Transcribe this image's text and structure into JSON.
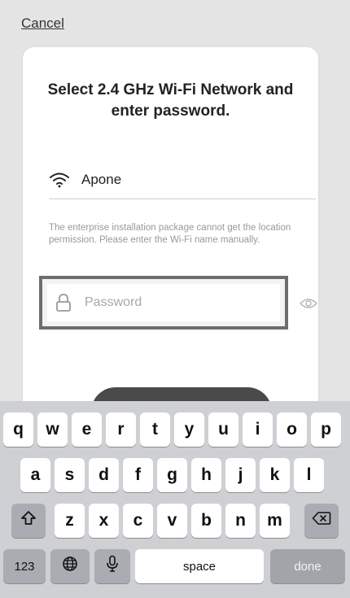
{
  "header": {
    "cancel_label": "Cancel"
  },
  "card": {
    "title": "Select 2.4 GHz Wi-Fi Network and enter password.",
    "wifi_name": "Apone",
    "wifi_icon": "wifi-icon",
    "notice": "The enterprise installation package cannot get the location permission. Please enter the Wi-Fi name manually.",
    "password_placeholder": "Password",
    "password_value": "",
    "lock_icon": "lock-icon",
    "eye_icon": "eye-icon"
  },
  "keyboard": {
    "row1": [
      "q",
      "w",
      "e",
      "r",
      "t",
      "y",
      "u",
      "i",
      "o",
      "p"
    ],
    "row2": [
      "a",
      "s",
      "d",
      "f",
      "g",
      "h",
      "j",
      "k",
      "l"
    ],
    "row3": [
      "z",
      "x",
      "c",
      "v",
      "b",
      "n",
      "m"
    ],
    "shift_icon": "shift-icon",
    "delete_icon": "delete-icon",
    "numbers_label": "123",
    "globe_icon": "globe-icon",
    "mic_icon": "microphone-icon",
    "space_label": "space",
    "done_label": "done"
  },
  "colors": {
    "background": "#e4e4e4",
    "card": "#ffffff",
    "highlight_border": "#6d6d6d",
    "confirm_button": "#4a4a4a",
    "keyboard_bg": "#cfd0d4",
    "done_key": "#a2a4aa"
  }
}
